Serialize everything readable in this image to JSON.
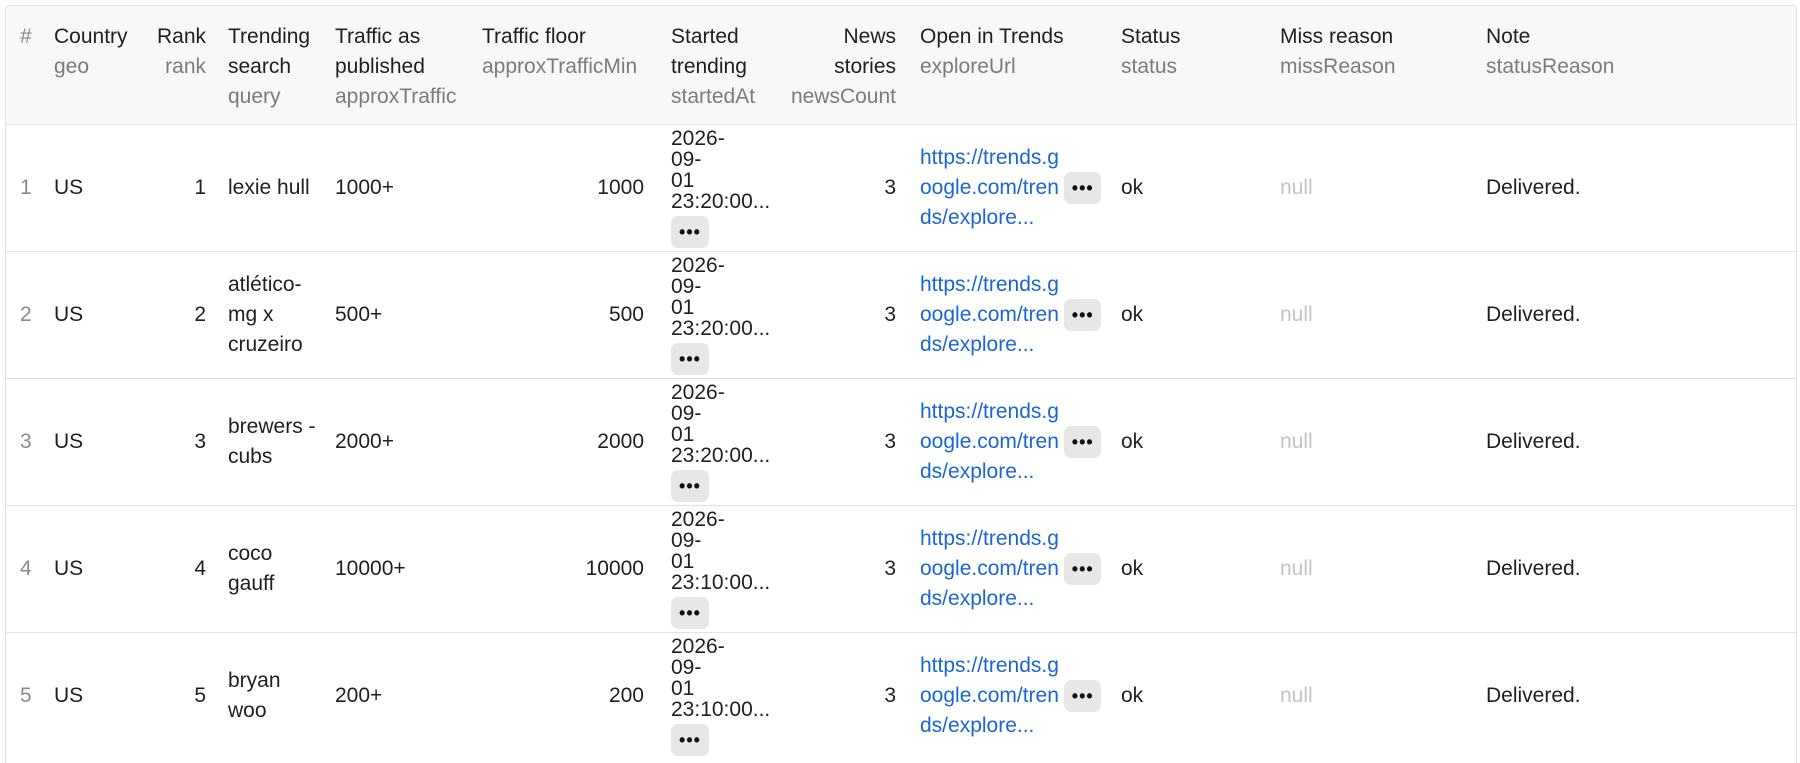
{
  "columns": {
    "index": {
      "title": "#"
    },
    "country": {
      "title": "Country",
      "field": "geo"
    },
    "rank": {
      "title": "Rank",
      "field": "rank"
    },
    "query": {
      "title": "Trending search",
      "field": "query"
    },
    "traffic": {
      "title": "Traffic as published",
      "field": "approxTraffic"
    },
    "floor": {
      "title": "Traffic floor",
      "field": "approxTrafficMin"
    },
    "started": {
      "title": "Started trending",
      "field": "startedAt"
    },
    "news": {
      "title": "News stories",
      "field": "newsCount"
    },
    "url": {
      "title": "Open in Trends",
      "field": "exploreUrl"
    },
    "status": {
      "title": "Status",
      "field": "status"
    },
    "miss": {
      "title": "Miss reason",
      "field": "missReason"
    },
    "note": {
      "title": "Note",
      "field": "statusReason"
    }
  },
  "more_glyph": "•••",
  "rows": [
    {
      "index": "1",
      "geo": "US",
      "rank": "1",
      "query": "lexie hull",
      "approxTraffic": "1000+",
      "approxTrafficMin": "1000",
      "startedAt": "2026-09-\n01\n23:20:00...",
      "newsCount": "3",
      "exploreUrl": "https://trends.google.com/trends/explore...",
      "status": "ok",
      "missReason": "null",
      "statusReason": "Delivered."
    },
    {
      "index": "2",
      "geo": "US",
      "rank": "2",
      "query": "atlético-mg x cruzeiro",
      "approxTraffic": "500+",
      "approxTrafficMin": "500",
      "startedAt": "2026-09-\n01\n23:20:00...",
      "newsCount": "3",
      "exploreUrl": "https://trends.google.com/trends/explore...",
      "status": "ok",
      "missReason": "null",
      "statusReason": "Delivered."
    },
    {
      "index": "3",
      "geo": "US",
      "rank": "3",
      "query": "brewers - cubs",
      "approxTraffic": "2000+",
      "approxTrafficMin": "2000",
      "startedAt": "2026-09-\n01\n23:20:00...",
      "newsCount": "3",
      "exploreUrl": "https://trends.google.com/trends/explore...",
      "status": "ok",
      "missReason": "null",
      "statusReason": "Delivered."
    },
    {
      "index": "4",
      "geo": "US",
      "rank": "4",
      "query": "coco gauff",
      "approxTraffic": "10000+",
      "approxTrafficMin": "10000",
      "startedAt": "2026-09-\n01\n23:10:00...",
      "newsCount": "3",
      "exploreUrl": "https://trends.google.com/trends/explore...",
      "status": "ok",
      "missReason": "null",
      "statusReason": "Delivered."
    },
    {
      "index": "5",
      "geo": "US",
      "rank": "5",
      "query": "bryan woo",
      "approxTraffic": "200+",
      "approxTrafficMin": "200",
      "startedAt": "2026-09-\n01\n23:10:00...",
      "newsCount": "3",
      "exploreUrl": "https://trends.google.com/trends/explore...",
      "status": "ok",
      "missReason": "null",
      "statusReason": "Delivered."
    }
  ]
}
